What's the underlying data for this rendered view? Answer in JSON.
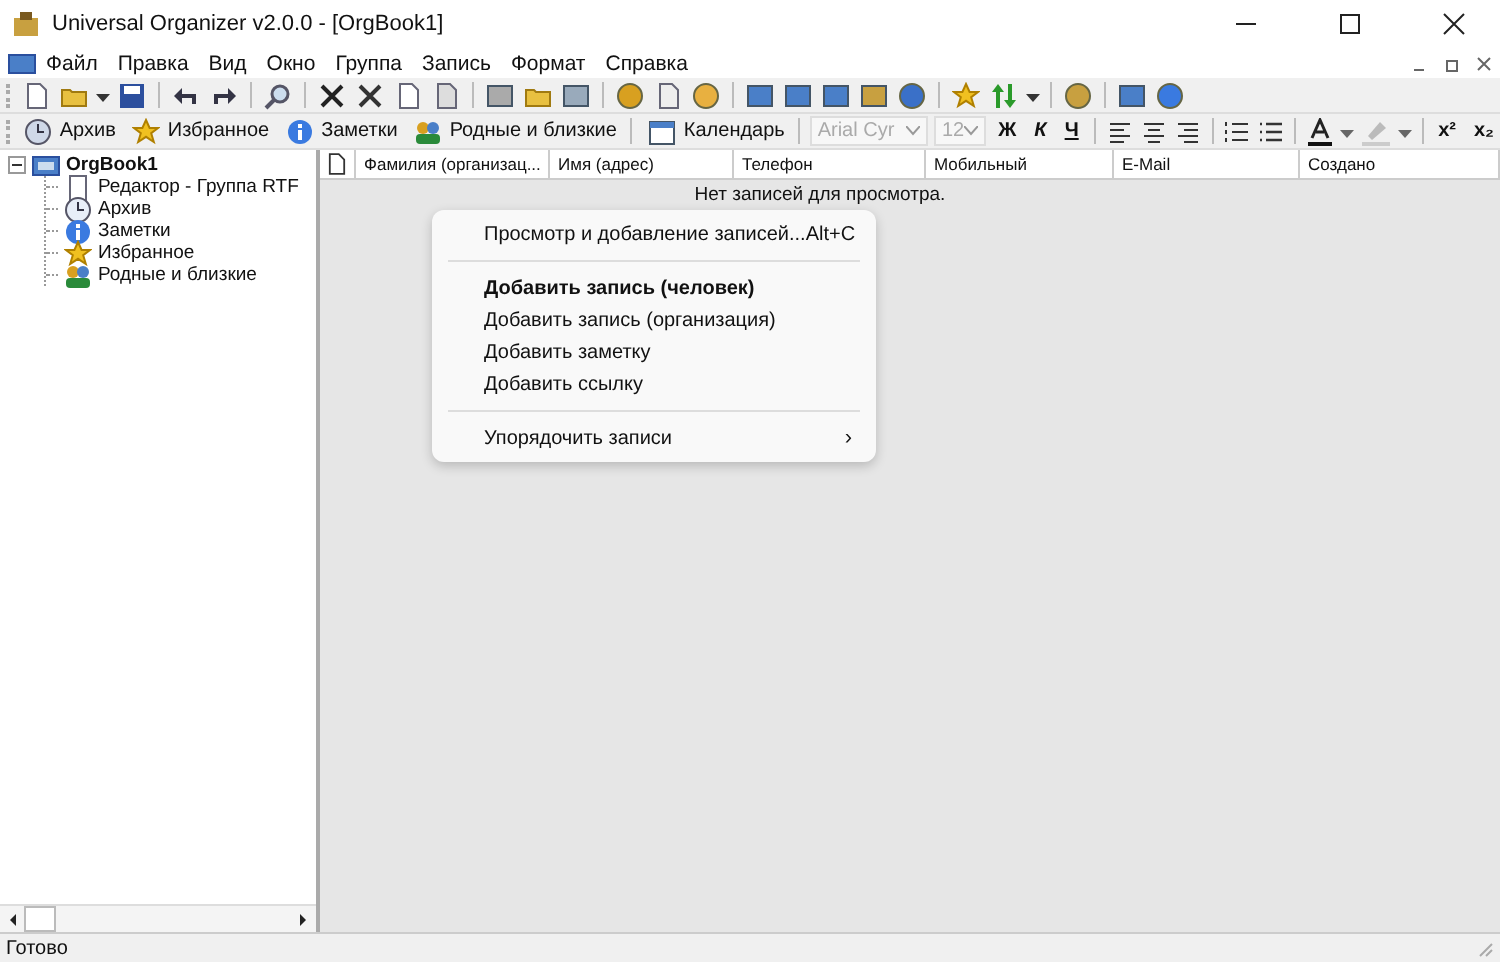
{
  "window": {
    "title": "Universal Organizer v2.0.0 - [OrgBook1]"
  },
  "menu": [
    "Файл",
    "Правка",
    "Вид",
    "Окно",
    "Группа",
    "Запись",
    "Формат",
    "Справка"
  ],
  "toolbar2": {
    "buttons": [
      {
        "label": "Архив"
      },
      {
        "label": "Избранное"
      },
      {
        "label": "Заметки"
      },
      {
        "label": "Родные и близкие"
      },
      {
        "label": "Календарь"
      }
    ],
    "font": {
      "value": "Arial Cyr",
      "disabled": true
    },
    "size": {
      "value": "12",
      "disabled": true
    },
    "format": [
      "Ж",
      "К",
      "Ч"
    ],
    "scripts": [
      "x²",
      "x₂"
    ]
  },
  "tree": [
    {
      "label": "OrgBook1",
      "expanded": true,
      "children": [
        {
          "label": "Редактор - Группа RTF"
        },
        {
          "label": "Архив"
        },
        {
          "label": "Заметки"
        },
        {
          "label": "Избранное"
        },
        {
          "label": "Родные и близкие"
        }
      ]
    }
  ],
  "table": {
    "columns": [
      "Фамилия (организац...",
      "Имя (адрес)",
      "Телефон",
      "Мобильный",
      "E-Mail",
      "Создано"
    ],
    "empty_message": "Нет записей для просмотра."
  },
  "context_menu": [
    {
      "kind": "item",
      "label": "Просмотр и добавление записей...",
      "shortcut": "Alt+C",
      "bold": false
    },
    {
      "kind": "separator"
    },
    {
      "kind": "item",
      "label": "Добавить запись (человек)",
      "bold": true
    },
    {
      "kind": "item",
      "label": "Добавить запись (организация)",
      "bold": false
    },
    {
      "kind": "item",
      "label": "Добавить заметку",
      "bold": false
    },
    {
      "kind": "item",
      "label": "Добавить ссылку",
      "bold": false
    },
    {
      "kind": "separator"
    },
    {
      "kind": "submenu",
      "label": "Упорядочить записи",
      "arrow": "›",
      "bold": false
    }
  ],
  "status_bar": "Готово"
}
